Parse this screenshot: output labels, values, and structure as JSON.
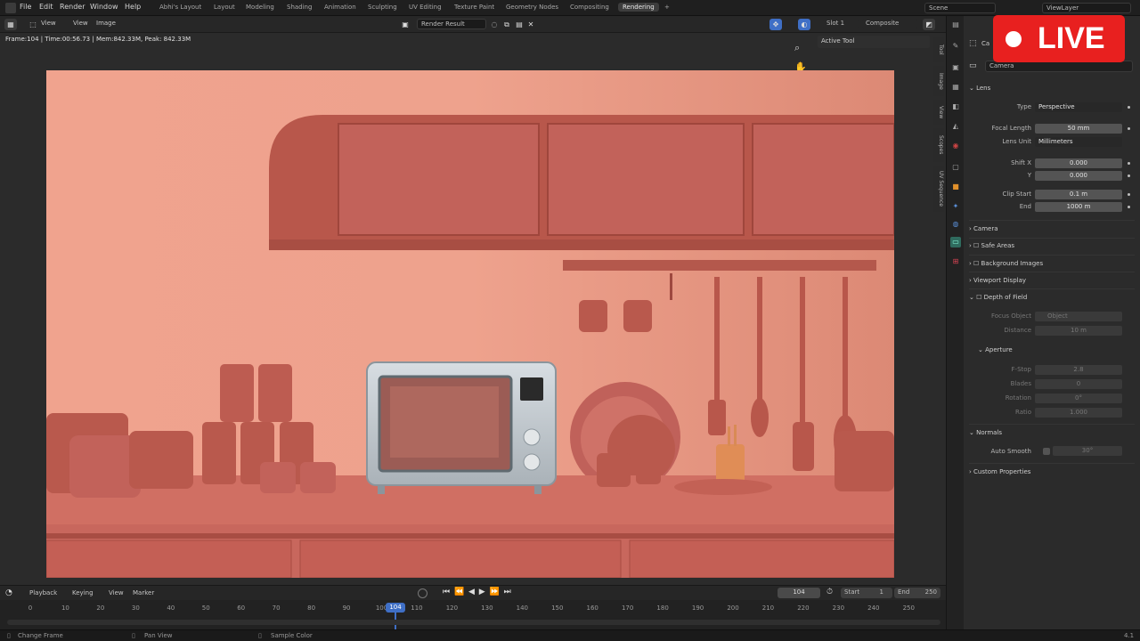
{
  "menu": [
    "File",
    "Edit",
    "Render",
    "Window",
    "Help"
  ],
  "workspaces": [
    "Abhi's Layout",
    "Layout",
    "Modeling",
    "Shading",
    "Animation",
    "Sculpting",
    "UV Editing",
    "Texture Paint",
    "Geometry Nodes",
    "Compositing",
    "Rendering"
  ],
  "active_workspace": "Rendering",
  "add_workspace": "+",
  "scene_field": "Scene",
  "viewlayer_field": "ViewLayer",
  "image_header": {
    "view": "View",
    "view2": "View",
    "image": "Image",
    "render_result": "Render Result",
    "slot": "Slot 1",
    "composite": "Composite"
  },
  "stats": "Frame:104 | Time:00:56.73 | Mem:842.33M, Peak: 842.33M",
  "active_tool": "Active Tool",
  "side_tabs": [
    "Tool",
    "Image",
    "View",
    "Scopes",
    "UV Sequence"
  ],
  "properties": {
    "header_label": "Ca",
    "object_name": "Camera",
    "lens": {
      "title": "Lens",
      "type_label": "Type",
      "type_value": "Perspective",
      "focal_label": "Focal Length",
      "focal_value": "50 mm",
      "lens_unit_label": "Lens Unit",
      "lens_unit_value": "Millimeters",
      "shiftx_label": "Shift X",
      "shiftx_value": "0.000",
      "shifty_label": "Y",
      "shifty_value": "0.000",
      "clipstart_label": "Clip Start",
      "clipstart_value": "0.1 m",
      "clipend_label": "End",
      "clipend_value": "1000 m"
    },
    "panels": [
      "Camera",
      "Safe Areas",
      "Background Images",
      "Viewport Display",
      "Depth of Field"
    ],
    "dof": {
      "focus_label": "Focus Object",
      "focus_placeholder": "Object",
      "distance_label": "Distance",
      "distance_value": "10 m",
      "aperture_title": "Aperture",
      "fstop_label": "F-Stop",
      "fstop_value": "2.8",
      "blades_label": "Blades",
      "blades_value": "0",
      "rotation_label": "Rotation",
      "rotation_value": "0°",
      "ratio_label": "Ratio",
      "ratio_value": "1.000"
    },
    "normals_title": "Normals",
    "autosmooth_label": "Auto Smooth",
    "autosmooth_value": "30°",
    "custom_props": "Custom Properties"
  },
  "live_badge": "LIVE",
  "timeline": {
    "playback": "Playback",
    "keying": "Keying",
    "view": "View",
    "marker": "Marker",
    "current_frame": "104",
    "start_label": "Start",
    "start_value": "1",
    "end_label": "End",
    "end_value": "250",
    "ticks": [
      "0",
      "10",
      "20",
      "30",
      "40",
      "50",
      "60",
      "70",
      "80",
      "90",
      "100",
      "110",
      "120",
      "130",
      "140",
      "150",
      "160",
      "170",
      "180",
      "190",
      "200",
      "210",
      "220",
      "230",
      "240",
      "250"
    ]
  },
  "status": {
    "left": "Change Frame",
    "mid": "Pan View",
    "right": "Sample Color",
    "version": "4.1"
  },
  "colors": {
    "live": "#e8201f",
    "render_bg": "#d27f6c",
    "frame_indicator": "#3f6fc6"
  }
}
